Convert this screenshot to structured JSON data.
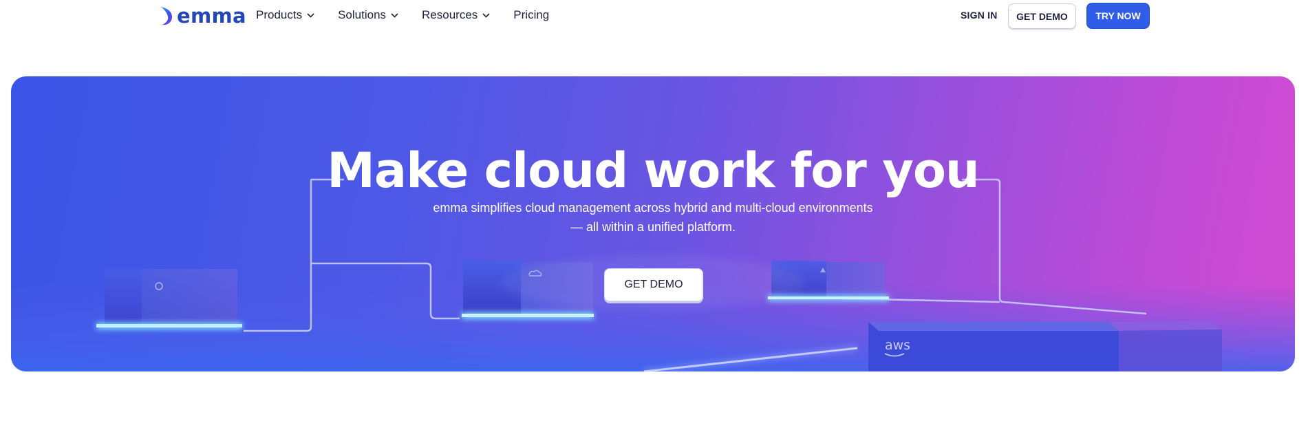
{
  "brand": {
    "name": "emma",
    "color": "#2346b8"
  },
  "nav": {
    "items": [
      {
        "label": "Products",
        "has_dropdown": true
      },
      {
        "label": "Solutions",
        "has_dropdown": true
      },
      {
        "label": "Resources",
        "has_dropdown": true
      },
      {
        "label": "Pricing",
        "has_dropdown": false
      }
    ]
  },
  "header_actions": {
    "sign_in": "SIGN IN",
    "get_demo": "GET DEMO",
    "try_now": "TRY NOW"
  },
  "hero": {
    "title": "Make cloud work for you",
    "subtitle_line1": "emma simplifies cloud management across hybrid and multi-cloud environments",
    "subtitle_line2": "— all within a unified platform.",
    "cta": "GET DEMO",
    "cube_logo_text": "aws"
  },
  "colors": {
    "accent": "#2f5de8",
    "hero_gradient_start": "#3b55e6",
    "hero_gradient_end": "#d24bd2"
  }
}
